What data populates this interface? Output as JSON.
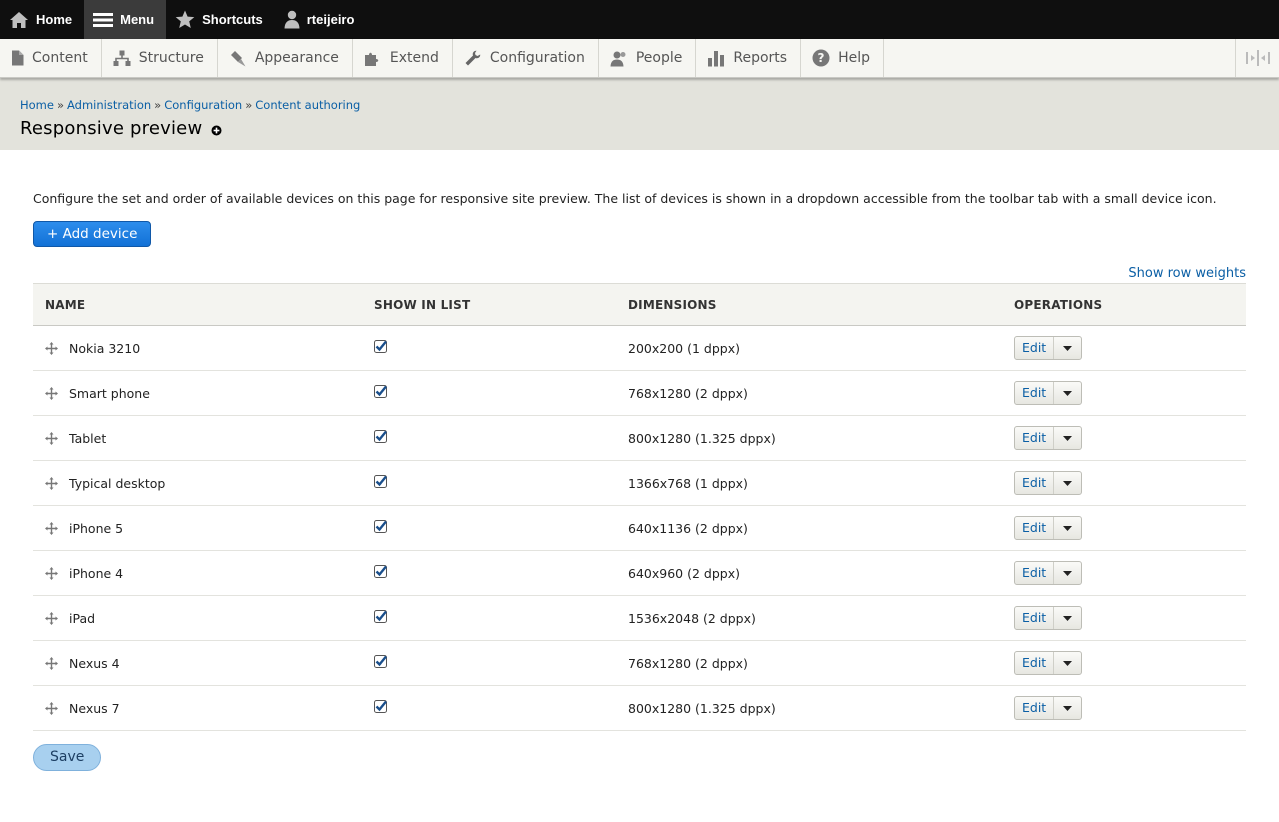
{
  "toolbar": {
    "home": "Home",
    "menu": "Menu",
    "shortcuts": "Shortcuts",
    "user": "rteijeiro"
  },
  "tray": {
    "items": [
      {
        "label": "Content",
        "icon": "file-icon"
      },
      {
        "label": "Structure",
        "icon": "structure-icon"
      },
      {
        "label": "Appearance",
        "icon": "paint-icon"
      },
      {
        "label": "Extend",
        "icon": "puzzle-icon"
      },
      {
        "label": "Configuration",
        "icon": "wrench-icon"
      },
      {
        "label": "People",
        "icon": "people-icon"
      },
      {
        "label": "Reports",
        "icon": "bar-chart-icon"
      },
      {
        "label": "Help",
        "icon": "help-icon"
      }
    ]
  },
  "breadcrumb": {
    "items": [
      "Home",
      "Administration",
      "Configuration",
      "Content authoring"
    ],
    "separator": "»"
  },
  "page": {
    "title": "Responsive preview",
    "description": "Configure the set and order of available devices on this page for responsive site preview. The list of devices is shown in a dropdown accessible from the toolbar tab with a small device icon.",
    "add_button": "+ Add device",
    "show_weights": "Show row weights",
    "save_button": "Save"
  },
  "table": {
    "headers": [
      "NAME",
      "SHOW IN LIST",
      "DIMENSIONS",
      "OPERATIONS"
    ],
    "rows": [
      {
        "name": "Nokia 3210",
        "checked": true,
        "dimensions": "200x200 (1 dppx)",
        "op": "Edit"
      },
      {
        "name": "Smart phone",
        "checked": true,
        "dimensions": "768x1280 (2 dppx)",
        "op": "Edit"
      },
      {
        "name": "Tablet",
        "checked": true,
        "dimensions": "800x1280 (1.325 dppx)",
        "op": "Edit"
      },
      {
        "name": "Typical desktop",
        "checked": true,
        "dimensions": "1366x768 (1 dppx)",
        "op": "Edit"
      },
      {
        "name": "iPhone 5",
        "checked": true,
        "dimensions": "640x1136 (2 dppx)",
        "op": "Edit"
      },
      {
        "name": "iPhone 4",
        "checked": true,
        "dimensions": "640x960 (2 dppx)",
        "op": "Edit"
      },
      {
        "name": "iPad",
        "checked": true,
        "dimensions": "1536x2048 (2 dppx)",
        "op": "Edit"
      },
      {
        "name": "Nexus 4",
        "checked": true,
        "dimensions": "768x1280 (2 dppx)",
        "op": "Edit"
      },
      {
        "name": "Nexus 7",
        "checked": true,
        "dimensions": "800x1280 (1.325 dppx)",
        "op": "Edit"
      }
    ]
  },
  "colors": {
    "toolbar_bg": "#0f0f0f",
    "link": "#0b5fa5",
    "primary_button": "#1b7ae0",
    "header_bg": "#e3e3dc"
  }
}
